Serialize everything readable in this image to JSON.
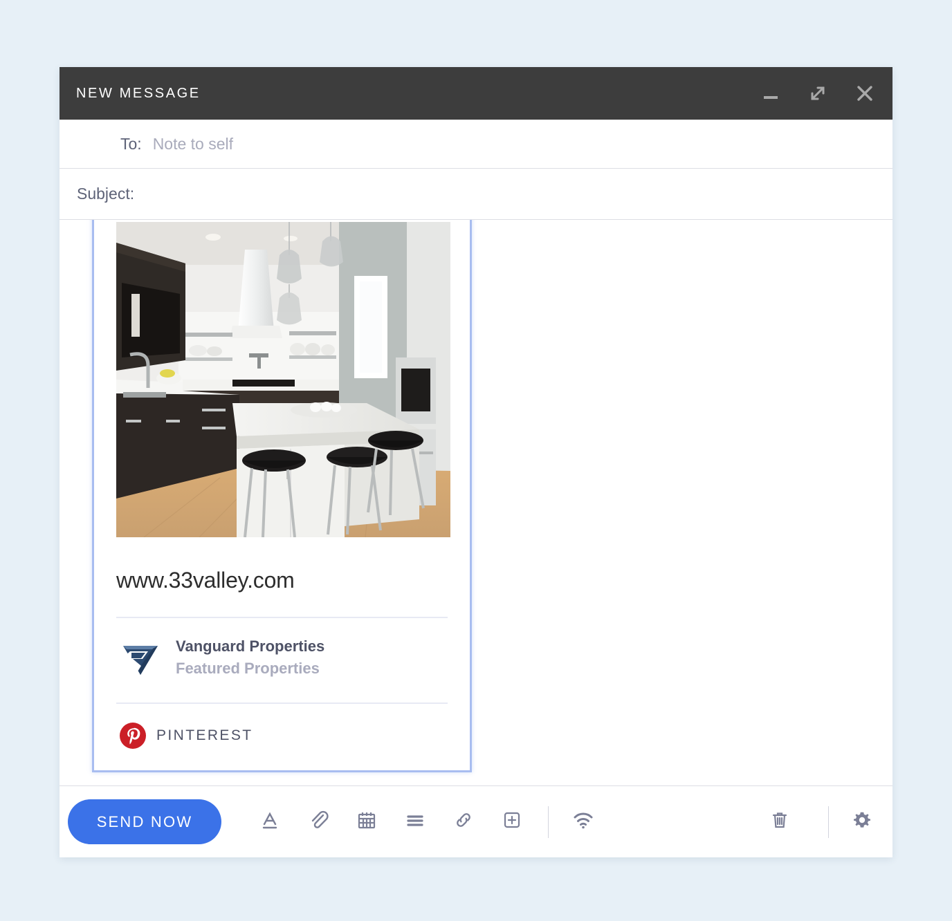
{
  "page": {
    "background_color": "#e7f0f7"
  },
  "window": {
    "title": "NEW MESSAGE",
    "header_color": "#3d3d3d",
    "controls": [
      {
        "name": "minimize",
        "icon": "minimize-icon"
      },
      {
        "name": "expand",
        "icon": "expand-icon"
      },
      {
        "name": "close",
        "icon": "close-icon"
      }
    ]
  },
  "fields": {
    "to": {
      "label": "To:",
      "value": "Note to self",
      "placeholder": "Note to self"
    },
    "subject": {
      "label": "Subject:",
      "value": "",
      "placeholder": ""
    }
  },
  "pin_card": {
    "border_color": "#a8bdf0",
    "image_alt": "modern-kitchen-photo",
    "url": "www.33valley.com",
    "brand": {
      "logo_icon": "vanguard-triangle-logo",
      "logo_color": "#2c4a70",
      "name": "Vanguard Properties",
      "subtitle": "Featured Properties"
    },
    "source": {
      "icon": "pinterest-icon",
      "icon_color": "#cb1f27",
      "label": "PINTEREST"
    }
  },
  "toolbar": {
    "send_label": "SEND NOW",
    "send_color": "#3b72e8",
    "icon_color": "#7b7f96",
    "icons_left": [
      {
        "name": "text-format-icon",
        "label": "A"
      },
      {
        "name": "attachment-icon",
        "label": "Attach file"
      },
      {
        "name": "calendar-icon",
        "label": "Insert date"
      },
      {
        "name": "list-icon",
        "label": "List"
      },
      {
        "name": "link-icon",
        "label": "Insert link"
      },
      {
        "name": "add-box-icon",
        "label": "Insert"
      }
    ],
    "icons_right": [
      {
        "name": "wifi-icon",
        "label": "Connection"
      },
      {
        "name": "trash-icon",
        "label": "Discard"
      },
      {
        "name": "gear-icon",
        "label": "Settings"
      }
    ]
  }
}
